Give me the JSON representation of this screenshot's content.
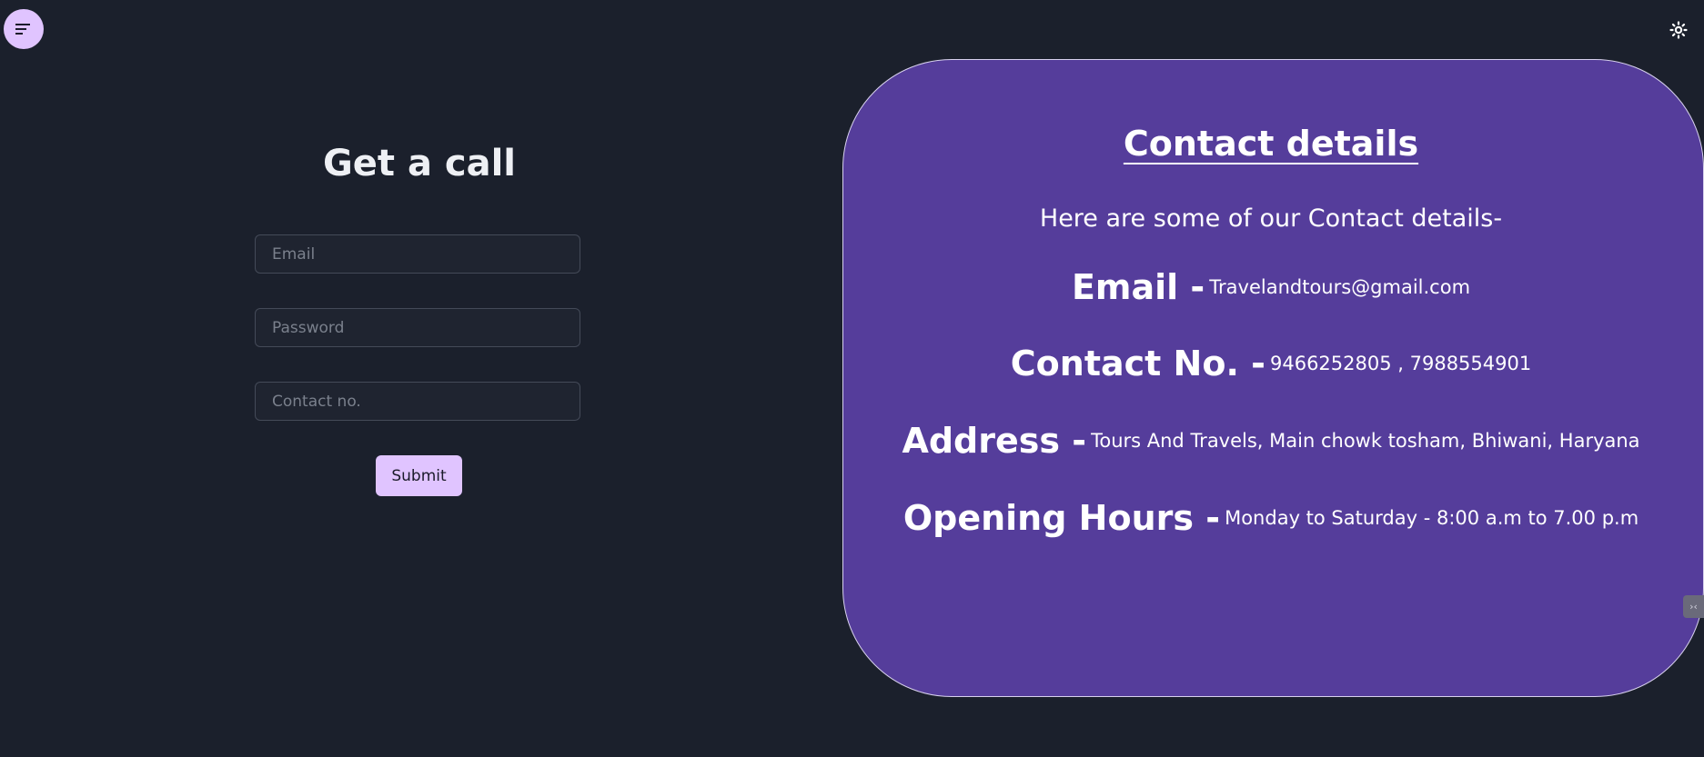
{
  "header": {
    "menu_icon": "menu-icon",
    "theme_icon": "sun-icon"
  },
  "form": {
    "title": "Get a call",
    "email_placeholder": "Email",
    "password_placeholder": "Password",
    "contact_placeholder": "Contact no.",
    "submit_label": "Submit"
  },
  "contact": {
    "title": "Contact details",
    "intro": "Here are some of our Contact details-",
    "email_label": "Email -",
    "email_value": "Travelandtours@gmail.com",
    "phone_label": "Contact No. -",
    "phone_value": "9466252805 , 7988554901",
    "address_label": "Address -",
    "address_value": "Tours And Travels, Main chowk tosham, Bhiwani, Haryana",
    "hours_label": "Opening Hours -",
    "hours_value": "Monday to Saturday - 8:00 a.m to 7.00 p.m"
  },
  "colors": {
    "background": "#1b202c",
    "accent": "#e0c4ff",
    "card": "#553d9b"
  }
}
